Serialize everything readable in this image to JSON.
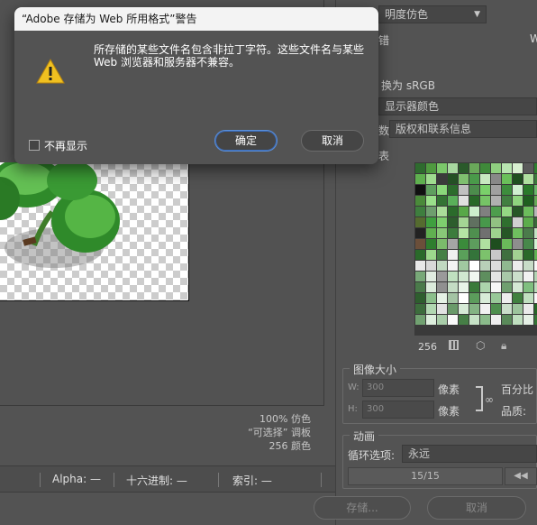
{
  "dialog": {
    "title": "“Adobe 存储为 Web 所用格式”警告",
    "message": "所存储的某些文件名包含非拉丁字符。这些文件名与某些 Web 浏览器和服务器不兼容。",
    "checkbox_label": "不再显示",
    "ok_label": "确定",
    "cancel_label": "取消"
  },
  "preview": {
    "dither_info": "100% 仿色",
    "palette_info": "“可选择” 调板",
    "colors_info": "256 颜色"
  },
  "statusbar": {
    "alpha": "Alpha: —",
    "hex": "十六进制: —",
    "index": "索引: —"
  },
  "right_panel": {
    "top_dropdown": "明度仿色",
    "top_partial": "错",
    "top_partial2": "W",
    "convert_srgb": "换为 sRGB",
    "display_color": "显示器颜色",
    "metadata_label": "数:",
    "metadata_value": "版权和联系信息",
    "color_table_label": "表",
    "palette_count": "256",
    "image_size": {
      "title": "图像大小",
      "w_label": "W:",
      "w_value": "300",
      "w_unit": "像素",
      "h_label": "H:",
      "h_value": "300",
      "h_unit": "像素",
      "percent_label": "百分比",
      "quality_label": "品质:"
    },
    "animation": {
      "title": "动画",
      "loop_label": "循环选项:",
      "loop_value": "永远",
      "frame": "15/15",
      "prev_icon": "◀◀"
    }
  },
  "bottom": {
    "save_label": "存储...",
    "cancel_label": "取消"
  },
  "palette_colors": [
    "#2e6b2e",
    "#4f9a3f",
    "#7bc86a",
    "#a8d8a0",
    "#2a5a2a",
    "#6aa85a",
    "#3f8a3a",
    "#8fcf7f",
    "#b8e6b0",
    "#d8f0d0",
    "#5a5a5a",
    "#2f7f2f",
    "#5fb04f",
    "#9fdc8f",
    "#3a3a3a",
    "#245024",
    "#7fbf6f",
    "#4a9a4a",
    "#c8e8c0",
    "#888888",
    "#6ac05a",
    "#1f4f1f",
    "#afe09f",
    "#3b7b3b",
    "#101010",
    "#5f9f5f",
    "#8ad87a",
    "#2c6c2c",
    "#c0c0c0",
    "#4c8c4c",
    "#7ad06a",
    "#a0a0a0",
    "#3d8d3d",
    "#cfefcf",
    "#2a7a2a",
    "#6ab86a",
    "#4a8a3a",
    "#9ae08a",
    "#337333",
    "#5ab05a",
    "#e0e0e0",
    "#286828",
    "#76c466",
    "#b0b0b0",
    "#417f41",
    "#8fd47f",
    "#1f5f1f",
    "#66aa56",
    "#3e7e3e",
    "#6e9e6e",
    "#aadd99",
    "#2b6b2b",
    "#58a848",
    "#cceecc",
    "#808080",
    "#4d9d4d",
    "#94d884",
    "#275727",
    "#6cbc5c",
    "#b8b8b8",
    "#556b2f",
    "#3f9f3f",
    "#7ece6e",
    "#2d5d2d",
    "#a4d494",
    "#607060",
    "#48984b",
    "#92c282",
    "#2f6f2f",
    "#d0d0d0",
    "#5cac4c",
    "#3a6a3a",
    "#222222",
    "#60b050",
    "#88c878",
    "#3c7c3c",
    "#b4e4a4",
    "#4f8f4f",
    "#707070",
    "#9ed48e",
    "#265626",
    "#6fbf5f",
    "#4b7b4b",
    "#c4e4c4",
    "#6b4f3a",
    "#2e7e2e",
    "#7bbb6b",
    "#a6a6a6",
    "#3b8b3b",
    "#5d9d5d",
    "#b0e0a0",
    "#1e4e1e",
    "#6aba5a",
    "#8e8e8e",
    "#48884b",
    "#d4f4d4",
    "#2a6a2a",
    "#9cd88c",
    "#457f45",
    "#f0f0f0",
    "#5aa05a",
    "#34743a",
    "#7cc26c",
    "#c8c8c8",
    "#3f6f3f",
    "#a2d292",
    "#296929",
    "#62b252",
    "#e8e8e8",
    "#d8d8d8",
    "#c0d8c0",
    "#f4f4f4",
    "#a0c8a0",
    "#ffffff",
    "#b8d0b8",
    "#dcdcdc",
    "#90b890",
    "#ececec",
    "#c8dcc8",
    "#f8f8f8",
    "#78a878",
    "#e0ece0",
    "#9a9a9a",
    "#bfe0bf",
    "#d0e8d0",
    "#f0f8f0",
    "#5e8e5e",
    "#e4e4e4",
    "#a8c8a8",
    "#cce0cc",
    "#f2f2f2",
    "#b4d4b4",
    "#4a7a4a",
    "#dcecdc",
    "#909090",
    "#c4dcc4",
    "#e8f4e8",
    "#3a7a3a",
    "#acd4ac",
    "#f6f6f6",
    "#6f9f6f",
    "#d4e8d4",
    "#7fbf7f",
    "#bcdcbc",
    "#2e5e2e",
    "#8cc08c",
    "#e6f2e6",
    "#a4c4a4",
    "#ffffff",
    "#5c9c5c",
    "#d8ecd8",
    "#98c898",
    "#ededed",
    "#40803f",
    "#c0e0c0",
    "#f9f9f9",
    "#3c6c3c",
    "#b2d8b2",
    "#e2e2e2",
    "#6a9a6a",
    "#d6ead6",
    "#83b383",
    "#f1f1f1",
    "#4e8e4e",
    "#cadeca",
    "#9cc49c",
    "#eaeaea",
    "#266626",
    "#71a171",
    "#ddeedd",
    "#a9cda9",
    "#fafafa",
    "#467e46",
    "#c6e2c6",
    "#8bbb8b",
    "#efefef",
    "#5a8a5a",
    "#bfdfbf",
    "#e5f0e5",
    "#357535"
  ]
}
